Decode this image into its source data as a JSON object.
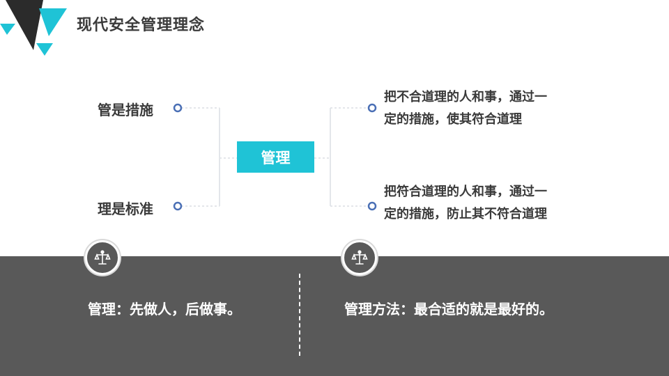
{
  "title": "现代安全管理理念",
  "center_label": "管理",
  "left_items": [
    {
      "label": "管是措施"
    },
    {
      "label": "理是标准"
    }
  ],
  "right_items": [
    {
      "line1": "把不合道理的人和事，通过一",
      "line2": "定的措施，使其符合道理"
    },
    {
      "line1": "把符合道理的人和事，通过一",
      "line2": "定的措施，防止其不符合道理"
    }
  ],
  "bottom": {
    "left_text": "管理：先做人，后做事。",
    "right_text": "管理方法：最合适的就是最好的。",
    "left_icon": "scales-icon",
    "right_icon": "scales-icon"
  },
  "colors": {
    "accent": "#1fc3d6",
    "dark": "#3a3a3a",
    "band": "#595959",
    "node": "#4a6fb5"
  }
}
